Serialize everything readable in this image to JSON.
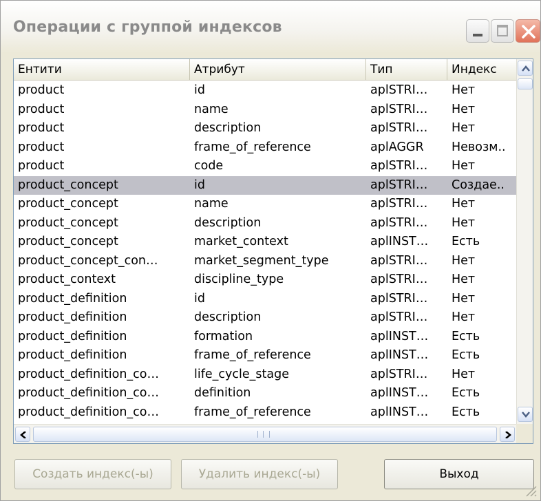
{
  "window": {
    "title": "Операции с группой индексов"
  },
  "list": {
    "columns": [
      "Ентити",
      "Атрибут",
      "Тип",
      "Индекс"
    ],
    "selected_index": 5,
    "rows": [
      [
        "product",
        "id",
        "aplSTRI…",
        "Нет"
      ],
      [
        "product",
        "name",
        "aplSTRI…",
        "Нет"
      ],
      [
        "product",
        "description",
        "aplSTRI…",
        "Нет"
      ],
      [
        "product",
        "frame_of_reference",
        "aplAGGR",
        "Невозм.."
      ],
      [
        "product",
        "code",
        "aplSTRI…",
        "Нет"
      ],
      [
        "product_concept",
        "id",
        "aplSTRI…",
        "Создае.."
      ],
      [
        "product_concept",
        "name",
        "aplSTRI…",
        "Нет"
      ],
      [
        "product_concept",
        "description",
        "aplSTRI…",
        "Нет"
      ],
      [
        "product_concept",
        "market_context",
        "aplINST…",
        "Есть"
      ],
      [
        "product_concept_con…",
        "market_segment_type",
        "aplSTRI…",
        "Нет"
      ],
      [
        "product_context",
        "discipline_type",
        "aplSTRI…",
        "Нет"
      ],
      [
        "product_definition",
        "id",
        "aplSTRI…",
        "Нет"
      ],
      [
        "product_definition",
        "description",
        "aplSTRI…",
        "Нет"
      ],
      [
        "product_definition",
        "formation",
        "aplINST…",
        "Есть"
      ],
      [
        "product_definition",
        "frame_of_reference",
        "aplINST…",
        "Есть"
      ],
      [
        "product_definition_co…",
        "life_cycle_stage",
        "aplSTRI…",
        "Нет"
      ],
      [
        "product_definition_co…",
        "definition",
        "aplINST…",
        "Есть"
      ],
      [
        "product_definition_co…",
        "frame_of_reference",
        "aplINST…",
        "Есть"
      ]
    ]
  },
  "buttons": {
    "create_label": "Создать индекс(-ы)",
    "delete_label": "Удалить индекс(-ы)",
    "exit_label": "Выход"
  },
  "icons": {
    "minimize": "minimize-icon",
    "maximize": "maximize-icon",
    "close": "close-icon",
    "scroll_up": "arrow-up-icon",
    "scroll_down": "arrow-down-icon",
    "scroll_left": "arrow-left-icon",
    "scroll_right": "arrow-right-icon",
    "resize": "resize-grip-icon"
  },
  "colors": {
    "selected_row": "#c0c0c8",
    "disabled_text": "#a9a893",
    "close_button": "#e0735a"
  }
}
